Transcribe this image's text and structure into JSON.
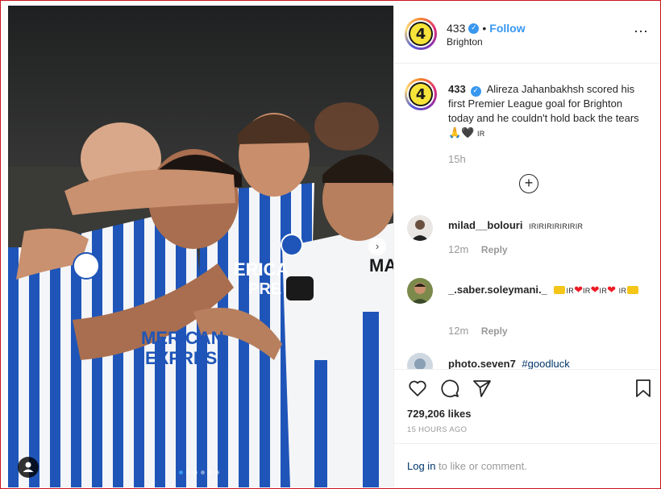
{
  "post": {
    "username": "433",
    "follow_label": "Follow",
    "separator": "•",
    "location": "Brighton",
    "avatar_text": "4",
    "more_icon": "⋯"
  },
  "caption": {
    "username": "433",
    "text": "Alireza Jahanbakhsh scored his first Premier League goal for Brighton today and he couldn't hold back the tears 🙏🖤",
    "tail": "IR",
    "time": "15h",
    "load_more_icon": "+"
  },
  "comments": [
    {
      "username": "milad__bolouri",
      "text": "IRIRIRIRIRIRIR",
      "time": "12m",
      "reply_label": "Reply"
    },
    {
      "username": "_.saber.soleymani._",
      "segments": [
        "IR",
        "IR",
        "IR",
        "IR"
      ],
      "time": "12m",
      "reply_label": "Reply"
    },
    {
      "username": "photo.seven7",
      "text": "#goodluck"
    }
  ],
  "stats": {
    "likes": "729,206 likes",
    "ago": "15 HOURS AGO"
  },
  "login": {
    "link": "Log in",
    "rest": " to like or comment."
  },
  "photo": {
    "jersey_text_1": "ERICA",
    "jersey_text_2": "PRE",
    "jersey_text_3": "MERICAN",
    "jersey_text_4": "EXPRESS",
    "jersey_name": "MA",
    "carousel_dots": 6,
    "active_dot": 0
  },
  "colors": {
    "accent": "#3897f0",
    "hashtag": "#003569",
    "border": "#c8141e"
  },
  "icons": [
    "heart-icon",
    "comment-icon",
    "share-icon",
    "bookmark-icon",
    "verified-icon",
    "add-circle-icon",
    "user-tag-icon",
    "next-arrow-icon"
  ]
}
